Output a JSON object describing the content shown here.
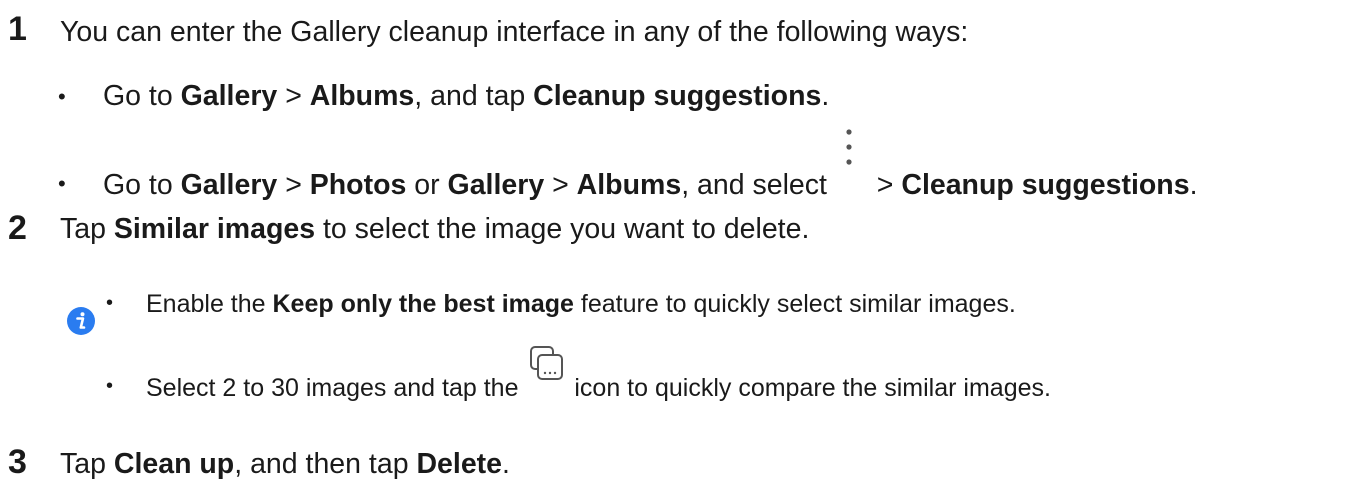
{
  "steps": [
    {
      "number": "1",
      "intro": "You can enter the Gallery cleanup interface in any of the following ways:",
      "bullets": [
        {
          "go_to": "Go to ",
          "gallery": "Gallery",
          "gt": " > ",
          "albums": "Albums",
          "and_tap": ", and tap ",
          "cleanup": "Cleanup suggestions",
          "end": "."
        },
        {
          "go_to": "Go to ",
          "gallery": "Gallery",
          "gt": " > ",
          "photos": "Photos",
          "or": " or ",
          "gallery2": "Gallery",
          "gt2": " > ",
          "albums": "Albums",
          "and_select": ", and select ",
          "icon": "more-vertical-icon",
          "gt3": " > ",
          "cleanup": "Cleanup suggestions",
          "end": "."
        }
      ]
    },
    {
      "number": "2",
      "pre": "Tap ",
      "similar": "Similar images",
      "post": " to select the image you want to delete.",
      "note_icon": "info-icon",
      "notes": [
        {
          "pre": "Enable the ",
          "keep": "Keep only the best image",
          "post": " feature to quickly select similar images."
        },
        {
          "pre": "Select 2 to 30 images and tap the ",
          "icon": "compare-icon",
          "post": " icon to quickly compare the similar images."
        }
      ]
    },
    {
      "number": "3",
      "pre": "Tap ",
      "clean": "Clean up",
      "mid": ", and then tap ",
      "delete": "Delete",
      "end": "."
    }
  ],
  "bullet_char": "•",
  "colors": {
    "text": "#1a1a1a",
    "info_blue": "#2a7cf0"
  }
}
